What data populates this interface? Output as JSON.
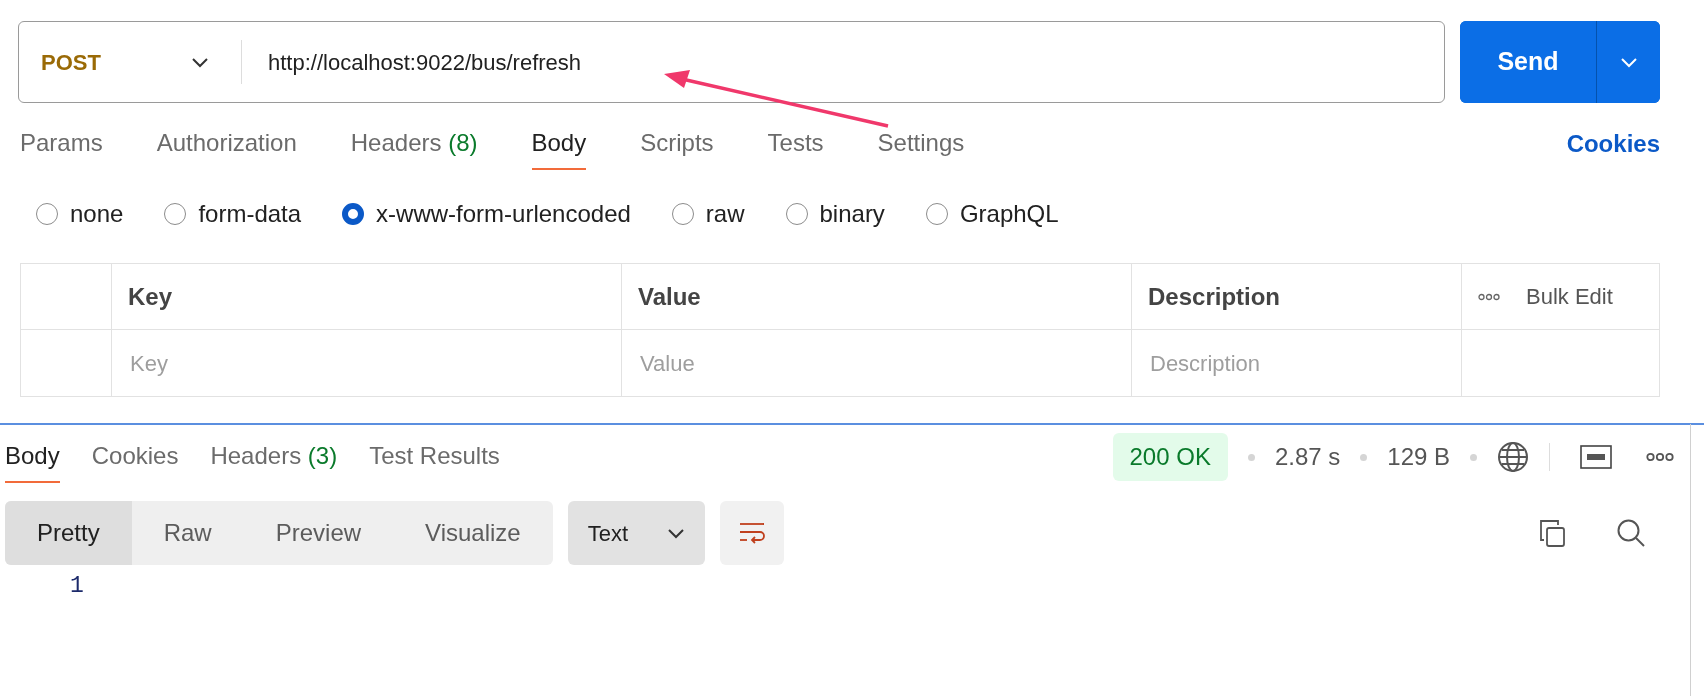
{
  "request": {
    "method": "POST",
    "url": "http://localhost:9022/bus/refresh",
    "send": "Send"
  },
  "request_tabs": [
    {
      "label": "Params",
      "selected": false
    },
    {
      "label": "Authorization",
      "selected": false
    },
    {
      "label": "Headers",
      "count": "(8)",
      "selected": false
    },
    {
      "label": "Body",
      "selected": true
    },
    {
      "label": "Scripts",
      "selected": false
    },
    {
      "label": "Tests",
      "selected": false
    },
    {
      "label": "Settings",
      "selected": false
    }
  ],
  "cookies_link": "Cookies",
  "body_types": [
    {
      "label": "none",
      "selected": false
    },
    {
      "label": "form-data",
      "selected": false
    },
    {
      "label": "x-www-form-urlencoded",
      "selected": true
    },
    {
      "label": "raw",
      "selected": false
    },
    {
      "label": "binary",
      "selected": false
    },
    {
      "label": "GraphQL",
      "selected": false
    }
  ],
  "table": {
    "columns": [
      "Key",
      "Value",
      "Description"
    ],
    "bulk_edit": "Bulk Edit",
    "new_row": {
      "key_placeholder": "Key",
      "value_placeholder": "Value",
      "description_placeholder": "Description"
    }
  },
  "response": {
    "tabs": [
      {
        "label": "Body",
        "selected": true
      },
      {
        "label": "Cookies",
        "selected": false
      },
      {
        "label": "Headers",
        "count": "(3)",
        "selected": false
      },
      {
        "label": "Test Results",
        "selected": false
      }
    ],
    "status": "200 OK",
    "time": "2.87 s",
    "size": "129 B",
    "views": [
      {
        "label": "Pretty",
        "selected": true
      },
      {
        "label": "Raw",
        "selected": false
      },
      {
        "label": "Preview",
        "selected": false
      },
      {
        "label": "Visualize",
        "selected": false
      }
    ],
    "format": "Text",
    "line_numbers": [
      "1"
    ]
  }
}
